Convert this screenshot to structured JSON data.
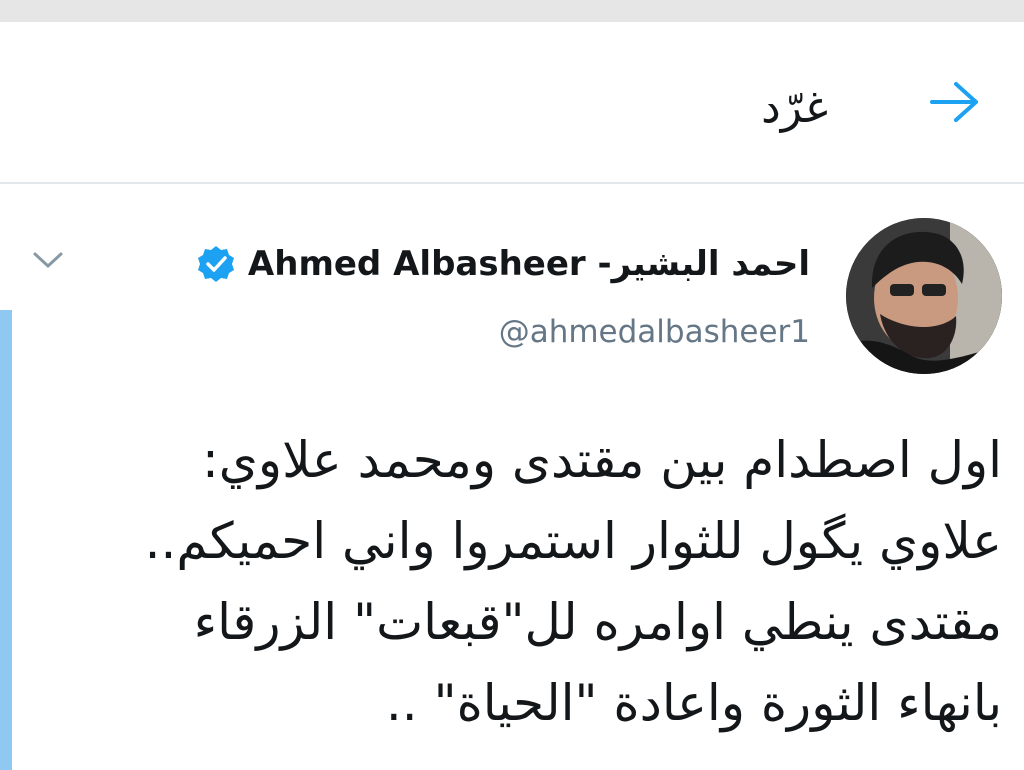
{
  "header": {
    "title": "غرّد",
    "back_icon": "arrow-right-icon"
  },
  "tweet": {
    "author": {
      "display_name": "Ahmed Albasheer -احمد البشير",
      "handle": "@ahmedalbasheer1",
      "verified": true,
      "verified_icon": "verified-badge-icon"
    },
    "menu_icon": "chevron-down-icon",
    "text_lines": [
      "اول اصطدام بين مقتدى ومحمد علاوي:",
      "علاوي يگول للثوار استمروا واني احميكم..",
      "مقتدى ينطي اوامره لل\"قبعات\" الزرقاء",
      "بانهاء الثورة واعادة \"الحياة\" .."
    ]
  },
  "colors": {
    "accent": "#1da1f2",
    "thread_line": "#8fc9f2",
    "text_primary": "#14171a",
    "text_secondary": "#657786",
    "divider": "#e1e8ed"
  }
}
